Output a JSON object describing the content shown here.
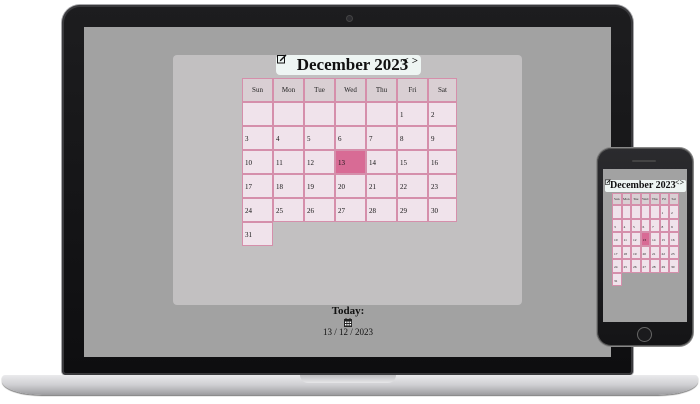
{
  "calendar": {
    "month_title": "December 2023",
    "prev_symbol": "<",
    "next_symbol": ">",
    "weekdays": [
      "Sun",
      "Mon",
      "Tue",
      "Wed",
      "Thu",
      "Fri",
      "Sat"
    ],
    "leading_blanks": 5,
    "days_in_month": 31,
    "selected_day": 13
  },
  "today": {
    "label": "Today:",
    "date": "13 / 12 / 2023"
  },
  "colors": {
    "cell": "#f0e3eb",
    "cell_border": "#d58fab",
    "header_cell": "#d9cfd3",
    "selected": "#d86b95",
    "panel": "#c2c0c1",
    "screen": "#a2a2a2",
    "title_bg": "#eef5f3"
  },
  "icons": {
    "edit": "edit-icon",
    "today": "calendar-icon"
  }
}
